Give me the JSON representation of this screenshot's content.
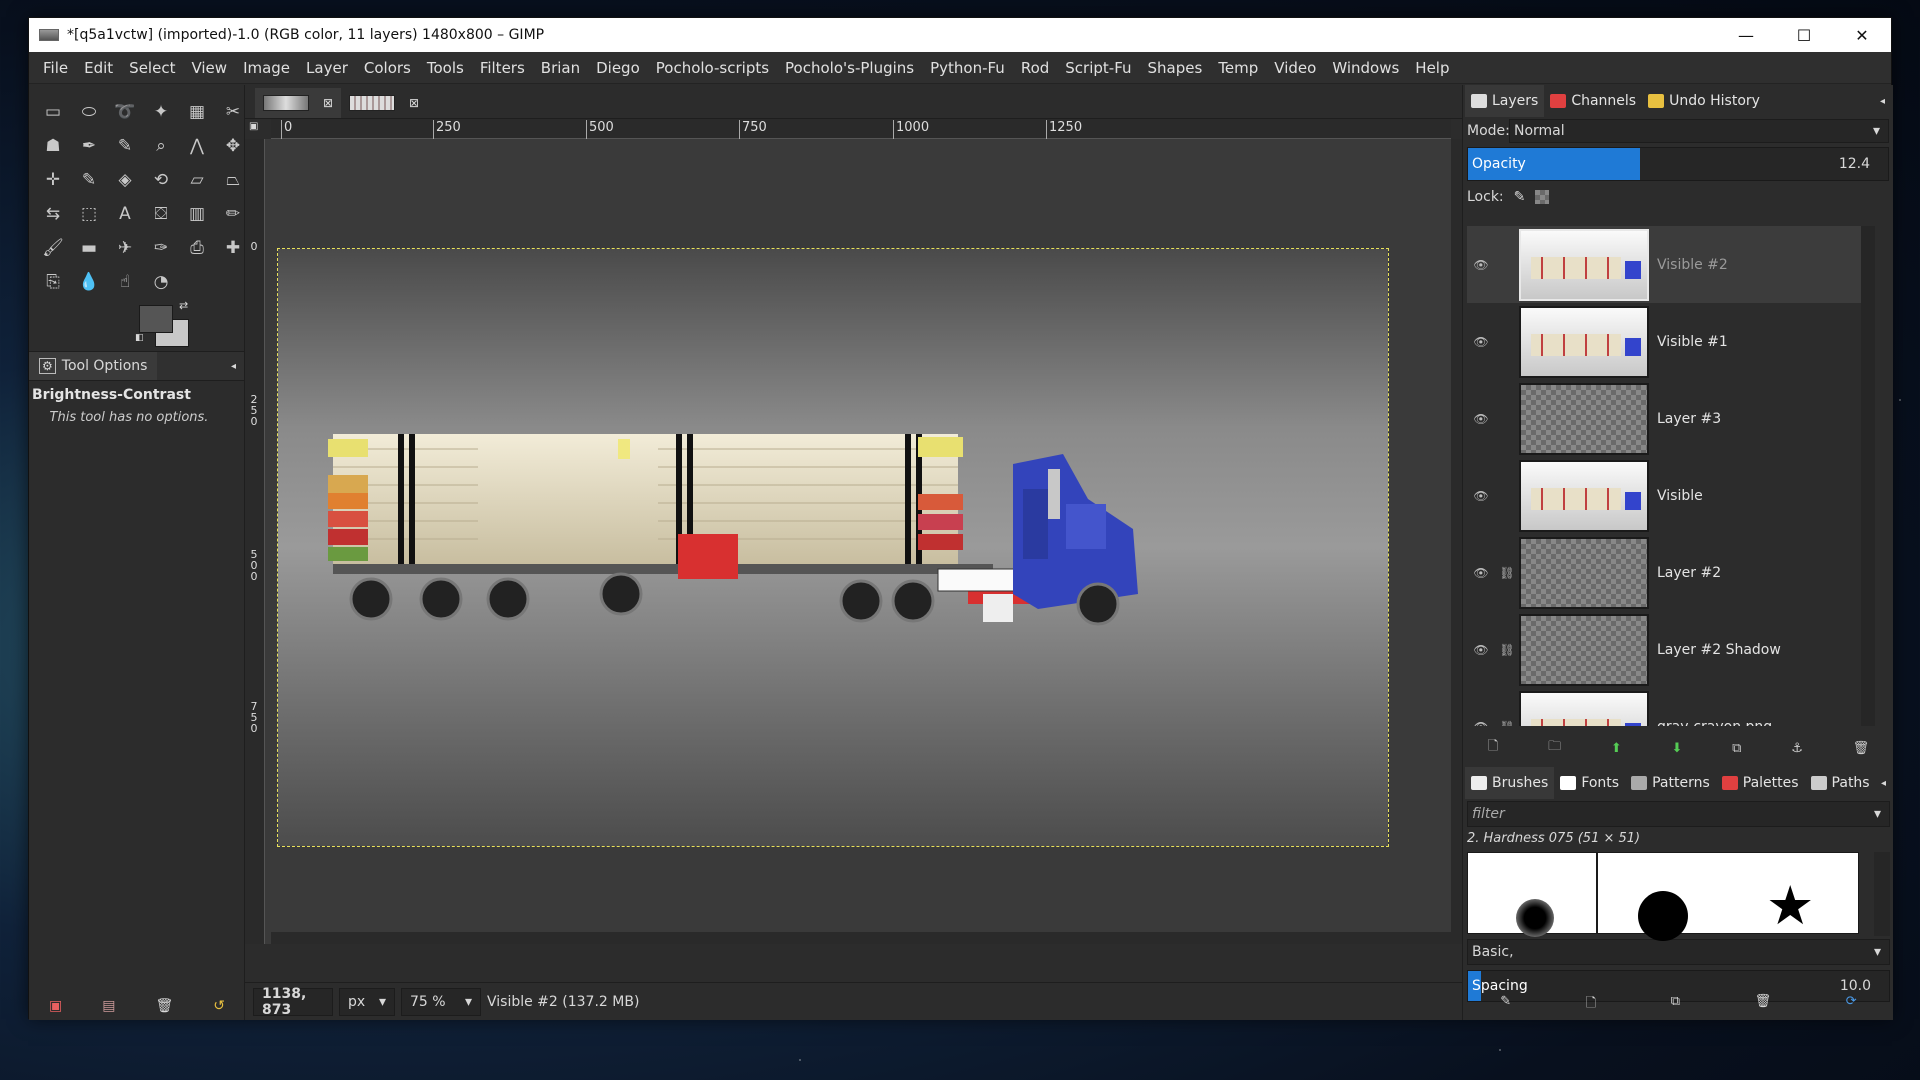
{
  "window": {
    "title": "*[q5a1vctw] (imported)-1.0 (RGB color, 11 layers) 1480x800 – GIMP",
    "min": "—",
    "max": "☐",
    "close": "✕"
  },
  "menu": [
    "File",
    "Edit",
    "Select",
    "View",
    "Image",
    "Layer",
    "Colors",
    "Tools",
    "Filters",
    "Brian",
    "Diego",
    "Pocholo-scripts",
    "Pocholo's-Plugins",
    "Python-Fu",
    "Rod",
    "Script-Fu",
    "Shapes",
    "Temp",
    "Video",
    "Windows",
    "Help"
  ],
  "tools": [
    {
      "name": "rect-select-icon",
      "glyph": "▭"
    },
    {
      "name": "ellipse-select-icon",
      "glyph": "⬭"
    },
    {
      "name": "free-select-icon",
      "glyph": "➰"
    },
    {
      "name": "fuzzy-select-icon",
      "glyph": "✦"
    },
    {
      "name": "color-select-icon",
      "glyph": "▦"
    },
    {
      "name": "scissors-select-icon",
      "glyph": "✂"
    },
    {
      "name": "foreground-select-icon",
      "glyph": "☗"
    },
    {
      "name": "paths-icon",
      "glyph": "✒"
    },
    {
      "name": "color-picker-icon",
      "glyph": "✎"
    },
    {
      "name": "zoom-icon",
      "glyph": "⌕"
    },
    {
      "name": "measure-icon",
      "glyph": "⋀"
    },
    {
      "name": "move-icon",
      "glyph": "✥"
    },
    {
      "name": "align-icon",
      "glyph": "✛"
    },
    {
      "name": "crop-icon",
      "glyph": "✎"
    },
    {
      "name": "unified-transform-icon",
      "glyph": "◈"
    },
    {
      "name": "rotate-icon",
      "glyph": "⟲"
    },
    {
      "name": "shear-icon",
      "glyph": "▱"
    },
    {
      "name": "perspective-icon",
      "glyph": "⏢"
    },
    {
      "name": "flip-icon",
      "glyph": "⇆"
    },
    {
      "name": "cage-icon",
      "glyph": "⬚"
    },
    {
      "name": "text-icon",
      "glyph": "A"
    },
    {
      "name": "bucket-fill-icon",
      "glyph": "⛋"
    },
    {
      "name": "gradient-icon",
      "glyph": "▥"
    },
    {
      "name": "pencil-icon",
      "glyph": "✏"
    },
    {
      "name": "paintbrush-icon",
      "glyph": "🖌"
    },
    {
      "name": "eraser-icon",
      "glyph": "▬"
    },
    {
      "name": "airbrush-icon",
      "glyph": "✈"
    },
    {
      "name": "ink-icon",
      "glyph": "✑"
    },
    {
      "name": "clone-icon",
      "glyph": "⎙"
    },
    {
      "name": "heal-icon",
      "glyph": "✚"
    },
    {
      "name": "perspective-clone-icon",
      "glyph": "⎘"
    },
    {
      "name": "blur-icon",
      "glyph": "💧"
    },
    {
      "name": "smudge-icon",
      "glyph": "☝"
    },
    {
      "name": "dodge-burn-icon",
      "glyph": "◔"
    }
  ],
  "tool_options": {
    "tab_label": "Tool Options",
    "tool_name": "Brightness-Contrast",
    "message": "This tool has no options."
  },
  "image_tabs": [
    "tab1",
    "tab2"
  ],
  "ruler_top": [
    "0",
    "250",
    "500",
    "750",
    "1000",
    "1250"
  ],
  "ruler_left": [
    "0",
    "250",
    "500",
    "750"
  ],
  "status": {
    "coords": "1138, 873",
    "unit": "px",
    "zoom": "75 %",
    "info": "Visible #2 (137.2 MB)"
  },
  "dock_tabs": [
    "Layers",
    "Channels",
    "Undo History"
  ],
  "layers_panel": {
    "mode_label": "Mode:",
    "mode_value": "Normal",
    "opacity_label": "Opacity",
    "opacity_value": "12.4",
    "opacity_fraction": 0.124,
    "lock_label": "Lock:",
    "layers": [
      {
        "name": "Visible #2",
        "thumb": "truck",
        "selected": true,
        "chain": false
      },
      {
        "name": "Visible #1",
        "thumb": "truck",
        "selected": false,
        "chain": false
      },
      {
        "name": "Layer #3",
        "thumb": "checker",
        "selected": false,
        "chain": false
      },
      {
        "name": "Visible",
        "thumb": "truck",
        "selected": false,
        "chain": false
      },
      {
        "name": "Layer #2",
        "thumb": "checker",
        "selected": false,
        "chain": true
      },
      {
        "name": "Layer #2 Shadow",
        "thumb": "checker",
        "selected": false,
        "chain": true
      },
      {
        "name": "gray-crayon.png",
        "thumb": "truck",
        "selected": false,
        "chain": true
      }
    ]
  },
  "brush_tabs": [
    "Brushes",
    "Fonts",
    "Patterns",
    "Palettes",
    "Paths"
  ],
  "brushes_panel": {
    "filter_placeholder": "filter",
    "brush_name": "2. Hardness 075 (51 × 51)",
    "tag_value": "Basic,",
    "spacing_label": "Spacing",
    "spacing_value": "10.0",
    "spacing_fraction": 0.03
  },
  "colors": {
    "accent": "#1f7ad6",
    "fg": "#555555",
    "bg": "#c8c8c8"
  }
}
